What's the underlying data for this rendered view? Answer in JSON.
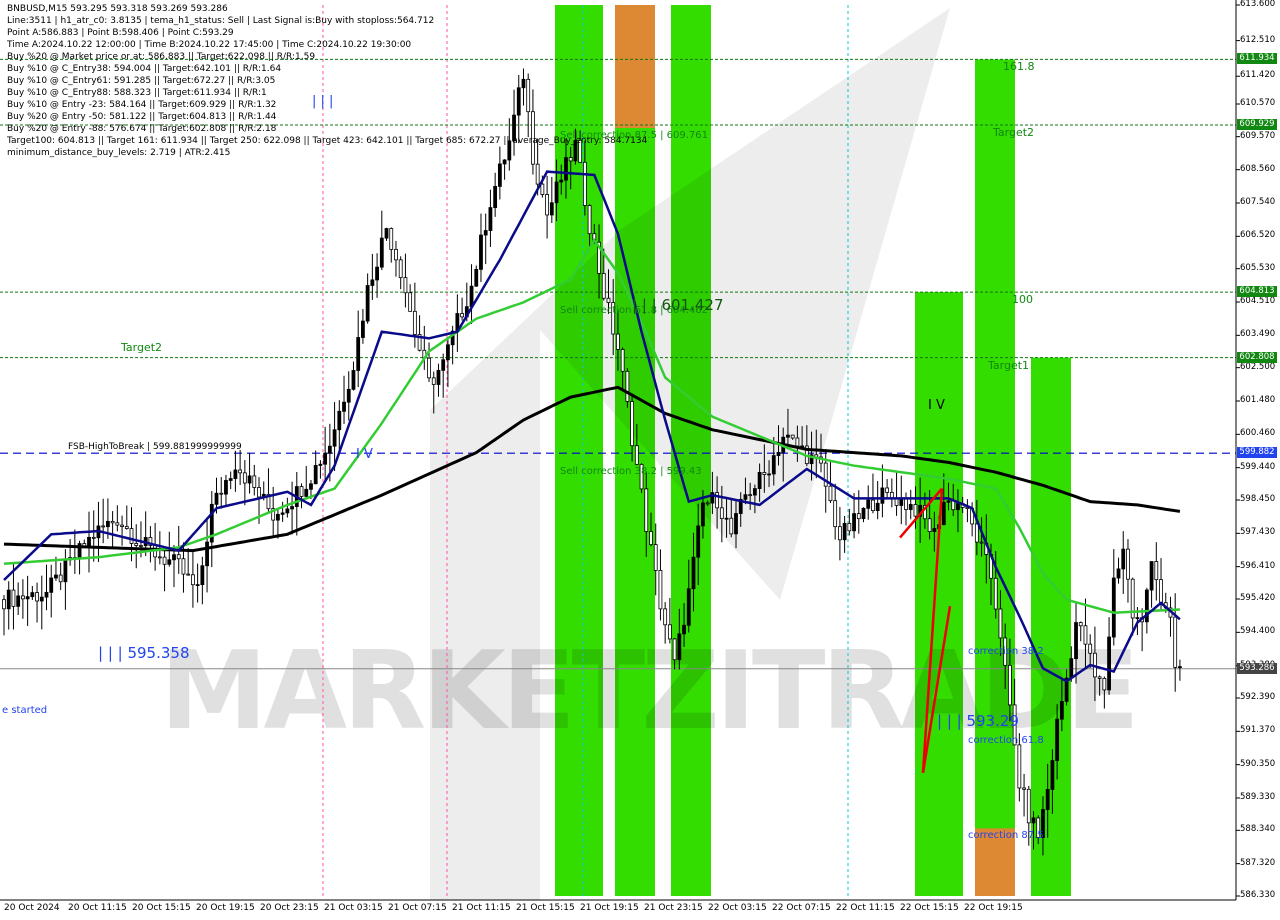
{
  "header": {
    "lines": [
      "BNBUSD,M15  593.295 593.318 593.269 593.286",
      "Line:3511  |  h1_atr_c0: 3.8135  |  tema_h1_status: Sell  |  Last Signal is:Buy with stoploss:564.712",
      "Point A:586.883  |  Point B:598.406  |  Point C:593.29",
      "Time A:2024.10.22 12:00:00  |  Time B:2024.10.22 17:45:00  |  Time C:2024.10.22 19:30:00",
      "Buy %20 @ Market price or at: 586.883  ||  Target:622.098  ||  R/R:1.59",
      "Buy %10 @ C_Entry38: 594.004  ||  Target:642.101  ||  R/R:1.64",
      "Buy %10 @ C_Entry61: 591.285  ||  Target:672.27  ||  R/R:3.05",
      "Buy %10 @ C_Entry88: 588.323  ||  Target:611.934  ||  R/R:1",
      "Buy %10 @ Entry -23: 584.164  ||  Target:609.929  ||  R/R:1.32",
      "Buy %20 @ Entry -50: 581.122  ||  Target:604.813  ||  R/R:1.44",
      "Buy %20 @ Entry -88: 576.674  ||  Target:602.808  ||  R/R:2.18",
      "Target100: 604.813  ||  Target 161: 611.934  ||  Target 250: 622.098  ||  Target 423: 642.101  ||  Target 685: 672.27  ||  average_Buy_entry: 584.7134",
      "minimum_distance_buy_levels: 2.719  |  ATR:2.415"
    ]
  },
  "watermark": "MARKETZITRADE",
  "colors": {
    "green_zone": "#33dd00",
    "orange_zone": "#dd8833",
    "ma_black": "#000000",
    "ma_green": "#33cc33",
    "ma_blue": "#0a0a8a",
    "level_line": "#117711",
    "dash_blue": "#0000cc",
    "badge_green": "#118811",
    "badge_blue": "#2244ee",
    "badge_gray": "#444444"
  },
  "chart_data": {
    "type": "candlestick",
    "symbol": "BNBUSD",
    "timeframe": "M15",
    "ylim": [
      586.33,
      613.6
    ],
    "y_ticks": [
      "613.600",
      "612.510",
      "611.420",
      "610.570",
      "609.570",
      "608.560",
      "607.540",
      "606.520",
      "605.530",
      "604.510",
      "603.490",
      "602.500",
      "601.480",
      "600.460",
      "599.440",
      "598.450",
      "597.430",
      "596.410",
      "595.420",
      "594.400",
      "593.380",
      "592.390",
      "591.370",
      "590.350",
      "589.330",
      "588.340",
      "587.320",
      "586.330"
    ],
    "x_ticks": [
      "20 Oct 2024",
      "20 Oct 11:15",
      "20 Oct 15:15",
      "20 Oct 19:15",
      "20 Oct 23:15",
      "21 Oct 03:15",
      "21 Oct 07:15",
      "21 Oct 11:15",
      "21 Oct 15:15",
      "21 Oct 19:15",
      "21 Oct 23:15",
      "22 Oct 03:15",
      "22 Oct 07:15",
      "22 Oct 11:15",
      "22 Oct 15:15",
      "22 Oct 19:15"
    ],
    "current_price": 593.286,
    "price_badges": [
      {
        "value": "611.934",
        "price": 611.934,
        "style": "green"
      },
      {
        "value": "609.929",
        "price": 609.929,
        "style": "green"
      },
      {
        "value": "604.813",
        "price": 604.813,
        "style": "green"
      },
      {
        "value": "602.808",
        "price": 602.808,
        "style": "green"
      },
      {
        "value": "599.882",
        "price": 599.882,
        "style": "blue"
      },
      {
        "value": "593.286",
        "price": 593.286,
        "style": "gray"
      }
    ],
    "levels": [
      {
        "price": 611.934,
        "label": "161.8"
      },
      {
        "price": 609.929,
        "label": "Target2"
      },
      {
        "price": 604.813,
        "label": "100"
      },
      {
        "price": 602.808,
        "label": "Target1"
      }
    ],
    "annotations": [
      {
        "text": "Sell correction 87.5 | 609.761",
        "price": 609.761
      },
      {
        "text": "Sell correction 61.8 | 604.462",
        "price": 604.462
      },
      {
        "text": "Sell correction 38.2 | 599.43",
        "price": 599.43
      },
      {
        "text": "| | | 601.427",
        "price": 601.427
      },
      {
        "text": "| | | 595.358",
        "price": 595.358
      },
      {
        "text": "| | | 593.29",
        "price": 593.29
      },
      {
        "text": "correction 38.2",
        "price": 594.0
      },
      {
        "text": "correction 61.8",
        "price": 591.3
      },
      {
        "text": "correction 87.5",
        "price": 588.3
      },
      {
        "text": "Target2",
        "price": 603.3
      },
      {
        "text": "FSB-HighToBreak | 599.881999999999",
        "price": 599.882
      },
      {
        "text": "e started",
        "price": 592.2
      },
      {
        "text": "| | |",
        "price": 610.5
      },
      {
        "text": "I V",
        "price": 601.3
      },
      {
        "text": "I V",
        "price": 599.8
      }
    ],
    "candle_anchors": [
      [
        0,
        595.4
      ],
      [
        10,
        595.6
      ],
      [
        20,
        597.4
      ],
      [
        25,
        597.9
      ],
      [
        30,
        597.1
      ],
      [
        38,
        596.4
      ],
      [
        42,
        595.6
      ],
      [
        45,
        598.2
      ],
      [
        50,
        599.6
      ],
      [
        54,
        598.8
      ],
      [
        58,
        598.0
      ],
      [
        62,
        598.5
      ],
      [
        66,
        599.2
      ],
      [
        70,
        600.2
      ],
      [
        75,
        602.6
      ],
      [
        78,
        604.9
      ],
      [
        82,
        606.8
      ],
      [
        85,
        605.5
      ],
      [
        88,
        603.6
      ],
      [
        91,
        602.0
      ],
      [
        94,
        602.6
      ],
      [
        97,
        603.9
      ],
      [
        100,
        605.0
      ],
      [
        104,
        607.6
      ],
      [
        108,
        609.4
      ],
      [
        111,
        611.5
      ],
      [
        113,
        609.0
      ],
      [
        116,
        607.2
      ],
      [
        119,
        608.3
      ],
      [
        122,
        609.3
      ],
      [
        125,
        606.9
      ],
      [
        128,
        604.8
      ],
      [
        131,
        603.1
      ],
      [
        134,
        600.4
      ],
      [
        137,
        597.7
      ],
      [
        140,
        595.3
      ],
      [
        143,
        593.4
      ],
      [
        146,
        595.6
      ],
      [
        149,
        598.3
      ],
      [
        152,
        598.5
      ],
      [
        155,
        597.4
      ],
      [
        158,
        598.6
      ],
      [
        162,
        599.2
      ],
      [
        166,
        600.4
      ],
      [
        170,
        600.0
      ],
      [
        174,
        599.4
      ],
      [
        178,
        597.3
      ],
      [
        182,
        597.9
      ],
      [
        186,
        598.6
      ],
      [
        190,
        598.5
      ],
      [
        194,
        598.2
      ],
      [
        198,
        597.4
      ],
      [
        200,
        598.4
      ],
      [
        204,
        598.3
      ],
      [
        207,
        597.3
      ],
      [
        210,
        596.1
      ],
      [
        212,
        594.4
      ],
      [
        214,
        592.0
      ],
      [
        216,
        589.8
      ],
      [
        218,
        588.8
      ],
      [
        220,
        588.2
      ],
      [
        222,
        589.6
      ],
      [
        224,
        591.6
      ],
      [
        226,
        593.0
      ],
      [
        228,
        594.7
      ],
      [
        230,
        594.1
      ],
      [
        232,
        593.0
      ],
      [
        234,
        592.7
      ],
      [
        236,
        596.0
      ],
      [
        238,
        597.0
      ],
      [
        240,
        594.9
      ],
      [
        242,
        594.6
      ],
      [
        244,
        596.8
      ],
      [
        246,
        595.4
      ],
      [
        248,
        594.6
      ],
      [
        249,
        593.3
      ]
    ],
    "total_candles": 250,
    "ma_black": [
      [
        0,
        597.1
      ],
      [
        20,
        597.0
      ],
      [
        40,
        596.9
      ],
      [
        60,
        597.4
      ],
      [
        80,
        598.6
      ],
      [
        100,
        599.9
      ],
      [
        110,
        600.9
      ],
      [
        120,
        601.6
      ],
      [
        130,
        601.9
      ],
      [
        140,
        601.1
      ],
      [
        150,
        600.6
      ],
      [
        160,
        600.3
      ],
      [
        170,
        600.0
      ],
      [
        180,
        599.9
      ],
      [
        190,
        599.8
      ],
      [
        200,
        599.6
      ],
      [
        210,
        599.3
      ],
      [
        220,
        598.9
      ],
      [
        230,
        598.4
      ],
      [
        240,
        598.3
      ],
      [
        249,
        598.1
      ]
    ],
    "ma_green": [
      [
        0,
        596.5
      ],
      [
        20,
        596.7
      ],
      [
        37,
        597.0
      ],
      [
        45,
        597.4
      ],
      [
        60,
        598.3
      ],
      [
        70,
        598.8
      ],
      [
        80,
        600.8
      ],
      [
        90,
        603.0
      ],
      [
        100,
        604.0
      ],
      [
        110,
        604.5
      ],
      [
        120,
        605.2
      ],
      [
        125,
        606.4
      ],
      [
        130,
        605.4
      ],
      [
        135,
        603.9
      ],
      [
        140,
        602.2
      ],
      [
        150,
        601.0
      ],
      [
        160,
        600.4
      ],
      [
        170,
        599.8
      ],
      [
        180,
        599.5
      ],
      [
        190,
        599.3
      ],
      [
        200,
        599.1
      ],
      [
        210,
        598.8
      ],
      [
        215,
        597.6
      ],
      [
        220,
        596.2
      ],
      [
        225,
        595.4
      ],
      [
        235,
        595.0
      ],
      [
        249,
        595.1
      ]
    ],
    "ma_blue": [
      [
        0,
        596.0
      ],
      [
        10,
        597.4
      ],
      [
        20,
        597.5
      ],
      [
        37,
        596.9
      ],
      [
        45,
        598.2
      ],
      [
        60,
        598.7
      ],
      [
        65,
        598.3
      ],
      [
        70,
        599.5
      ],
      [
        80,
        603.6
      ],
      [
        90,
        603.4
      ],
      [
        96,
        603.6
      ],
      [
        105,
        605.8
      ],
      [
        115,
        608.5
      ],
      [
        125,
        608.4
      ],
      [
        130,
        606.6
      ],
      [
        135,
        603.6
      ],
      [
        140,
        600.9
      ],
      [
        145,
        598.4
      ],
      [
        150,
        598.6
      ],
      [
        160,
        598.3
      ],
      [
        170,
        599.4
      ],
      [
        180,
        598.5
      ],
      [
        190,
        598.5
      ],
      [
        200,
        598.5
      ],
      [
        205,
        598.2
      ],
      [
        210,
        596.4
      ],
      [
        215,
        594.9
      ],
      [
        220,
        593.3
      ],
      [
        225,
        592.9
      ],
      [
        230,
        593.4
      ],
      [
        235,
        593.2
      ],
      [
        240,
        594.7
      ],
      [
        245,
        595.3
      ],
      [
        249,
        594.8
      ]
    ]
  }
}
